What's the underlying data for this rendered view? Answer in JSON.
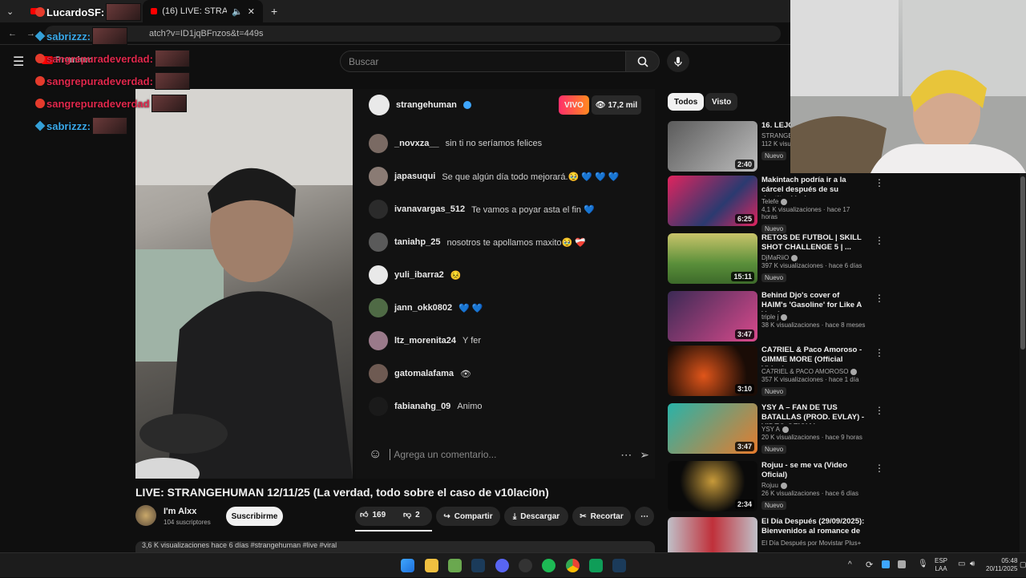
{
  "tabs": [
    {
      "label": "LucardoSF"
    },
    {
      "label": "(16) LIVE: STRANGEHUMAN"
    }
  ],
  "address": {
    "url": "atch?v=ID1jqBFnzos&t=449s"
  },
  "masthead": {
    "logo_suffix": "Premium",
    "search_placeholder": "Buscar"
  },
  "overlay_chat": [
    {
      "user": "LucardoSF:",
      "kind": "red"
    },
    {
      "user": "sabrizzz:",
      "kind": "blue"
    },
    {
      "user": "sangrepuradeverdad:",
      "kind": "red"
    },
    {
      "user": "sangrepuradeverdad:",
      "kind": "red"
    },
    {
      "user": "sangrepuradeverdad:",
      "kind": "red"
    },
    {
      "user": "sangrepuradeverdad",
      "kind": "red"
    },
    {
      "user": "sabrizzz:",
      "kind": "blue"
    }
  ],
  "stream": {
    "host": "strangehuman",
    "live_label": "VIVO",
    "viewers": "17,2 mil",
    "comment_placeholder": "Agrega un comentario...",
    "comments": [
      {
        "user": "_novxza__",
        "text": "sin ti no seríamos felices"
      },
      {
        "user": "japasuqui",
        "text": "Se que algún día todo mejorará.🥹 💙 💙 💙"
      },
      {
        "user": "ivanavargas_512",
        "text": "Te vamos a poyar asta el fin 💙"
      },
      {
        "user": "taniahp_25",
        "text": "nosotros te apollamos maxito🥹 ❤️‍🩹"
      },
      {
        "user": "yuli_ibarra2",
        "text": "😣"
      },
      {
        "user": "jann_okk0802",
        "text": "💙 💙"
      },
      {
        "user": "ltz_morenita24",
        "text": "Y fer"
      },
      {
        "user": "gatomalafama",
        "text": "👁"
      },
      {
        "user": "fabianahg_09",
        "text": "Animo"
      }
    ]
  },
  "video": {
    "title": "LIVE: STRANGEHUMAN 12/11/25 (La verdad, todo sobre el caso de v10laci0n)",
    "channel": "I'm Alxx",
    "subscribers": "104 suscriptores",
    "subscribe_label": "Suscribirme",
    "likes": "169",
    "dislikes": "2",
    "share": "Compartir",
    "download": "Descargar",
    "clip": "Recortar",
    "description": "3,6 K visualizaciones  hace 6 días  #strangehuman #live #viral"
  },
  "filters": [
    "Todos",
    "Visto"
  ],
  "recommendations": [
    {
      "title": "16. LEJOS",
      "channel": "STRANGEHUMAN",
      "views": "112 K visualizaciones",
      "badge": "Nuevo",
      "duration": "2:40",
      "colors": [
        "#5b5b5b",
        "#bdbdbd"
      ]
    },
    {
      "title": "Makintach podría ir a la cárcel después de su destitución | ...",
      "channel": "Telefe",
      "views": "4,1 K visualizaciones · hace 17 horas",
      "badge": "Nuevo",
      "duration": "6:25",
      "colors": [
        "#e0245e",
        "#2b3a70"
      ]
    },
    {
      "title": "RETOS DE FUTBOL | SKILL SHOT CHALLENGE 5 | ...",
      "channel": "DjMaRiiO",
      "views": "397 K visualizaciones · hace 6 días",
      "badge": "Nuevo",
      "duration": "15:11",
      "colors": [
        "#5a8f3a",
        "#c9c46a"
      ]
    },
    {
      "title": "Behind Djo's cover of HAIM's 'Gasoline' for Like A Version ...",
      "channel": "triple j",
      "views": "38 K visualizaciones · hace 8 meses",
      "badge": "",
      "duration": "3:47",
      "colors": [
        "#3b2a55",
        "#d94a8c"
      ]
    },
    {
      "title": "CA7RIEL & Paco Amoroso - GIMME MORE (Official Video)",
      "channel": "CA7RIEL & PACO AMOROSO",
      "views": "357 K visualizaciones · hace 1 día",
      "badge": "Nuevo",
      "duration": "3:10",
      "colors": [
        "#1a0c06",
        "#e0551a"
      ]
    },
    {
      "title": "YSY A – FAN DE TUS BATALLAS (PROD. EVLAY) - VIDEO OFICIAL",
      "channel": "YSY A",
      "views": "20 K visualizaciones · hace 9 horas",
      "badge": "Nuevo",
      "duration": "3:47",
      "colors": [
        "#28b3a9",
        "#e77b2c"
      ]
    },
    {
      "title": "Rojuu - se me va (Video Oficial)",
      "channel": "Rojuu",
      "views": "26 K visualizaciones · hace 6 días",
      "badge": "Nuevo",
      "duration": "2:34",
      "colors": [
        "#0a0a0a",
        "#c79a3a"
      ]
    },
    {
      "title": "El Día Después (29/09/2025): Bienvenidos al romance de ...",
      "channel": "El Día Después por Movistar Plus+",
      "views": "",
      "badge": "",
      "duration": "",
      "colors": [
        "#c0c0c8",
        "#c0303a"
      ]
    }
  ],
  "tray": {
    "lang": "ESP",
    "layout": "LAA",
    "time": "05:48",
    "date": "20/11/2025"
  }
}
